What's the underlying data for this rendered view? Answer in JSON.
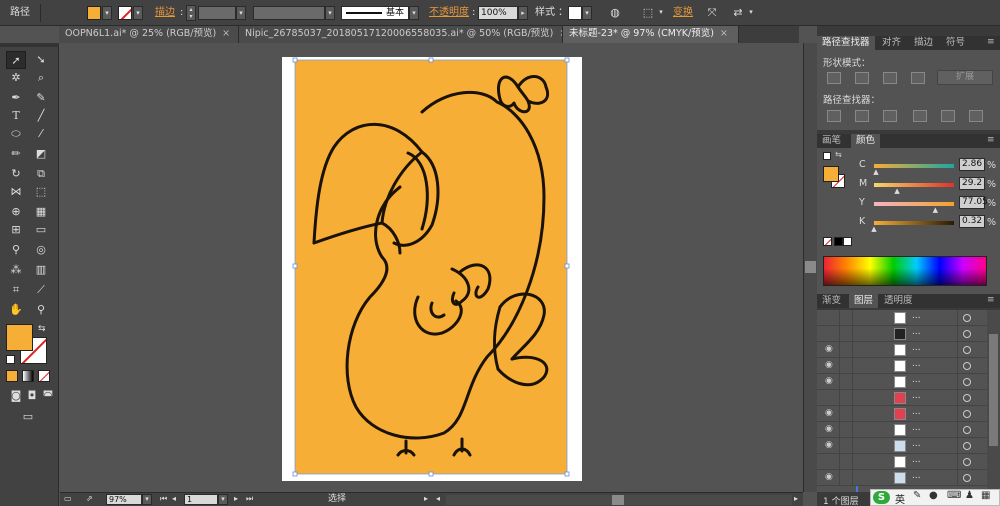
{
  "control_bar": {
    "object_type": "路径",
    "stroke_label": "描边",
    "stroke_profile": "基本",
    "opacity_label": "不透明度",
    "opacity_value": "100%",
    "style_label": "样式",
    "transform_label": "变换"
  },
  "tabs": [
    {
      "label": "OOPN6L1.ai* @ 25% (RGB/预览)"
    },
    {
      "label": "Nipic_26785037_20180517120006558035.ai* @ 50% (RGB/预览)"
    },
    {
      "label": "未标题-23* @ 97% (CMYK/预览)"
    }
  ],
  "status_bar": {
    "zoom": "97%",
    "artboard_number": "1",
    "tool_status": "选择"
  },
  "pathfinder_panel": {
    "tabs": [
      "路径查找器",
      "对齐",
      "描边",
      "符号"
    ],
    "shape_modes_label": "形状模式：",
    "expand_label": "扩展",
    "pathfinders_label": "路径查找器："
  },
  "color_panel": {
    "tabs": [
      "画笔",
      "颜色"
    ],
    "channels": [
      {
        "name": "C",
        "value": "2.86",
        "unit": "%",
        "level": 0.0286
      },
      {
        "name": "M",
        "value": "29.2",
        "unit": "%",
        "level": 0.292
      },
      {
        "name": "Y",
        "value": "77.05",
        "unit": "%",
        "level": 0.7705
      },
      {
        "name": "K",
        "value": "0.32",
        "unit": "%",
        "level": 0.0032
      }
    ]
  },
  "layers_panel": {
    "tabs": [
      "渐变",
      "图层",
      "透明度"
    ],
    "row_label": "...",
    "footer": "1 个图层"
  },
  "ime": {
    "lang": "英"
  },
  "colors": {
    "fill": "#f7ae36",
    "ink": "#1a1205",
    "accent_orange": "#e8963a",
    "layer_bar": "#4a78d8"
  }
}
